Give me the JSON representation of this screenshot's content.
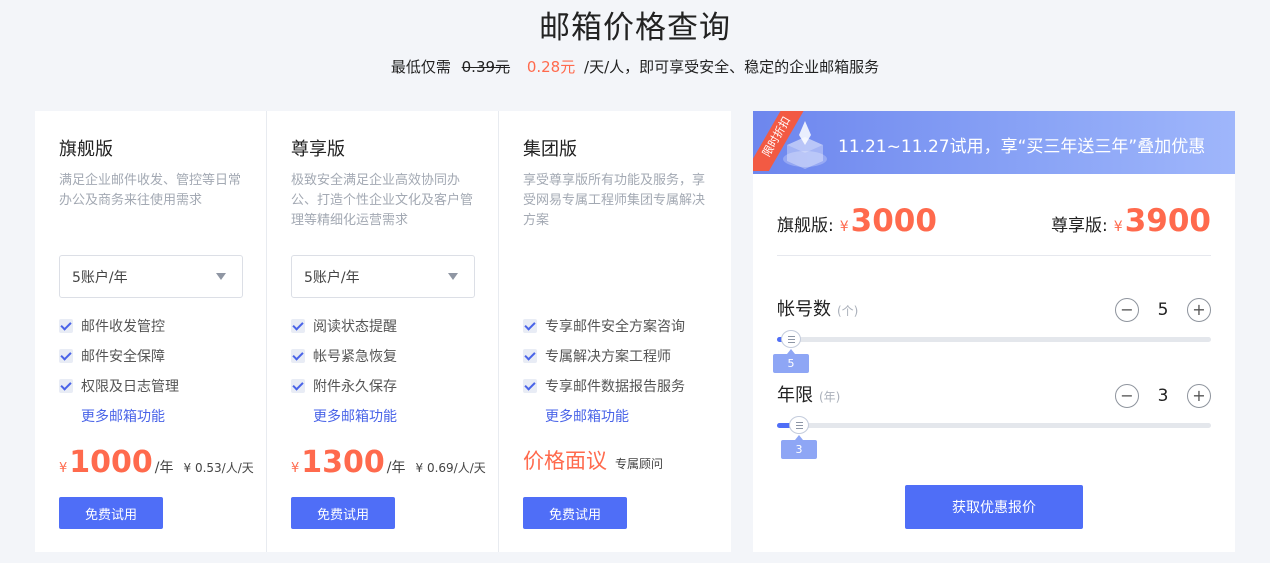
{
  "header": {
    "title": "邮箱价格查询",
    "subtitle_prefix": "最低仅需",
    "old_price": "0.39元",
    "new_price": "0.28元",
    "subtitle_suffix": "/天/人，即可享受安全、稳定的企业邮箱服务"
  },
  "plans": [
    {
      "name": "旗舰版",
      "desc": "满足企业邮件收发、管控等日常办公及商务来往使用需求",
      "select_value": "5账户/年",
      "features": [
        "邮件收发管控",
        "邮件安全保障",
        "权限及日志管理"
      ],
      "more_link": "更多邮箱功能",
      "currency": "¥",
      "price": "1000",
      "unit": "/年",
      "daily": "¥ 0.53/人/天",
      "button": "免费试用"
    },
    {
      "name": "尊享版",
      "desc": "极致安全满足企业高效协同办公、打造个性企业文化及客户管理等精细化运营需求",
      "select_value": "5账户/年",
      "features": [
        "阅读状态提醒",
        "帐号紧急恢复",
        "附件永久保存"
      ],
      "more_link": "更多邮箱功能",
      "currency": "¥",
      "price": "1300",
      "unit": "/年",
      "daily": "¥ 0.69/人/天",
      "button": "免费试用"
    },
    {
      "name": "集团版",
      "desc": "享受尊享版所有功能及服务，享受网易专属工程师集团专属解决方案",
      "features": [
        "专享邮件安全方案咨询",
        "专属解决方案工程师",
        "专享邮件数据报告服务"
      ],
      "more_link": "更多邮箱功能",
      "negotiate": "价格面议",
      "advisor": "专属顾问",
      "button": "免费试用"
    }
  ],
  "calculator": {
    "promo_badge": "限时折扣",
    "promo_text": "11.21~11.27试用，享“买三年送三年”叠加优惠",
    "offer_flagship_label": "旗舰版:",
    "offer_flagship_currency": "¥",
    "offer_flagship_price": "3000",
    "offer_premium_label": "尊享版:",
    "offer_premium_currency": "¥",
    "offer_premium_price": "3900",
    "accounts_label": "帐号数",
    "accounts_hint": "(个)",
    "accounts_value": "5",
    "accounts_fraction": 0.03,
    "years_label": "年限",
    "years_hint": "(年)",
    "years_value": "3",
    "years_fraction": 0.05,
    "minus": "−",
    "plus": "+",
    "quote_button": "获取优惠报价"
  },
  "colors": {
    "accent": "#4f6ef7",
    "price": "#ff6a4d",
    "promo_ribbon": "#f25a43"
  }
}
